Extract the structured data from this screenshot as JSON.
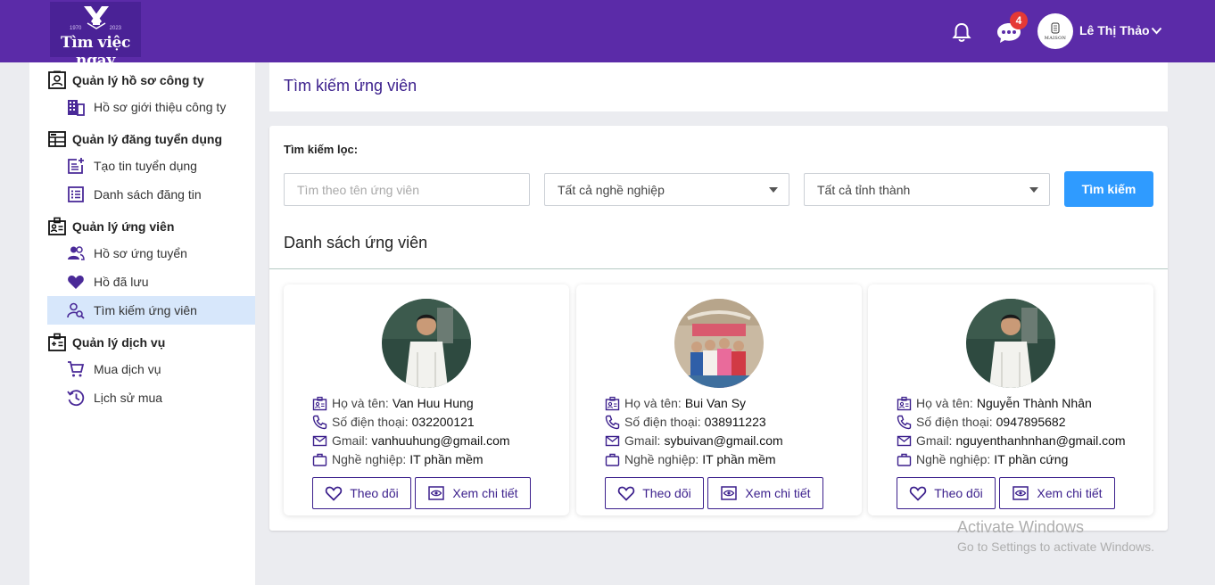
{
  "header": {
    "logo_text": "Tìm việc ngay",
    "logo_year_left": "1970",
    "logo_year_right": "2023",
    "notification_badge": "4",
    "avatar_text": "MAISON",
    "username": "Lê Thị Thảo"
  },
  "sidebar": {
    "groups": [
      {
        "label": "Quản lý hồ sơ công ty",
        "icon": "id-card-icon"
      },
      {
        "label": "Quản lý đăng tuyển dụng",
        "icon": "dashboard-icon"
      },
      {
        "label": "Quản lý ứng viên",
        "icon": "badge-icon"
      },
      {
        "label": "Quản lý dịch vụ",
        "icon": "service-icon"
      }
    ],
    "items": [
      {
        "label": "Hồ sơ giới thiệu công ty",
        "icon": "building-icon"
      },
      {
        "label": "Tạo tin tuyển dụng",
        "icon": "post-add-icon"
      },
      {
        "label": "Danh sách đăng tin",
        "icon": "list-icon"
      },
      {
        "label": "Hồ sơ ứng tuyển",
        "icon": "users-icon"
      },
      {
        "label": "Hồ đã lưu",
        "icon": "heart-icon"
      },
      {
        "label": "Tìm kiếm ứng viên",
        "icon": "user-search-icon",
        "active": true
      },
      {
        "label": "Mua dịch vụ",
        "icon": "cart-icon"
      },
      {
        "label": "Lịch sử mua",
        "icon": "history-icon"
      }
    ]
  },
  "page": {
    "title": "Tìm kiếm ứng viên",
    "filter_label": "Tìm kiếm lọc:",
    "search_placeholder": "Tìm theo tên ứng viên",
    "occupation_select": "Tất cả nghề nghiệp",
    "province_select": "Tất cả tỉnh thành",
    "search_button": "Tìm kiếm",
    "list_title": "Danh sách ứng viên"
  },
  "labels": {
    "name": "Họ và tên:",
    "phone": "Số điện thoại:",
    "email": "Gmail:",
    "job": "Nghề nghiệp:",
    "follow": "Theo dõi",
    "detail": "Xem chi tiết"
  },
  "candidates": [
    {
      "name": "Van Huu Hung",
      "phone": "032200121",
      "email": "vanhuuhung@gmail.com",
      "job": "IT phần mềm"
    },
    {
      "name": "Bui Van Sy",
      "phone": "038911223",
      "email": "sybuivan@gmail.com",
      "job": "IT phần mềm"
    },
    {
      "name": "Nguyễn Thành Nhân",
      "phone": "0947895682",
      "email": "nguyenthanhnhan@gmail.com",
      "job": "IT phần cứng"
    }
  ],
  "watermark": {
    "line1": "Activate Windows",
    "line2": "Go to Settings to activate Windows."
  },
  "colors": {
    "header": "#5b2ba8",
    "accent": "#3b1f8c",
    "button": "#2f9bff",
    "active_item": "#d7e7fb"
  }
}
